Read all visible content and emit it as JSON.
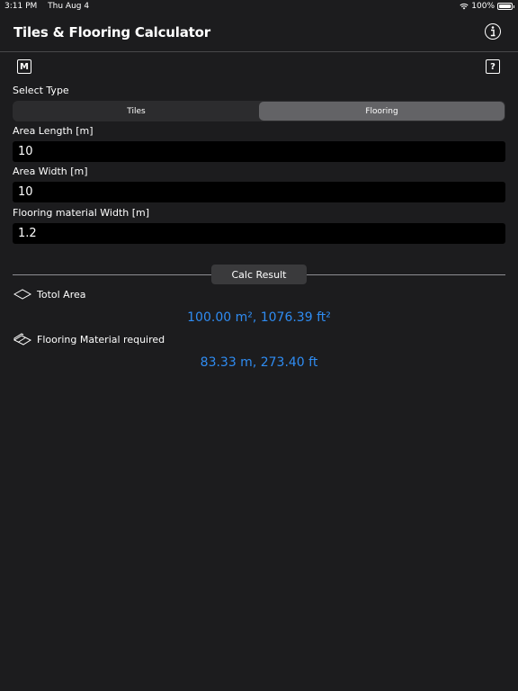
{
  "status_bar": {
    "time": "3:11 PM",
    "date": "Thu Aug 4",
    "battery": "100%"
  },
  "nav": {
    "title": "Tiles & Flooring Calculator",
    "info_icon": "info-circle-icon"
  },
  "toolbar": {
    "m_label": "M",
    "help_label": "?"
  },
  "select_type": {
    "label": "Select Type",
    "options": [
      "Tiles",
      "Flooring"
    ],
    "selected": "Flooring"
  },
  "fields": {
    "area_length": {
      "label": "Area Length [m]",
      "value": "10"
    },
    "area_width": {
      "label": "Area Width [m]",
      "value": "10"
    },
    "material_width": {
      "label": "Flooring material Width [m]",
      "value": "1.2"
    }
  },
  "calc_button": "Calc Result",
  "results": {
    "total_area": {
      "label": "Totol Area",
      "value": "100.00 m², 1076.39 ft²"
    },
    "material": {
      "label": "Flooring Material required",
      "value": "83.33 m, 273.40 ft"
    }
  },
  "colors": {
    "background": "#1c1c1e",
    "accent": "#2f8cf2",
    "selected_segment": "#636366"
  }
}
